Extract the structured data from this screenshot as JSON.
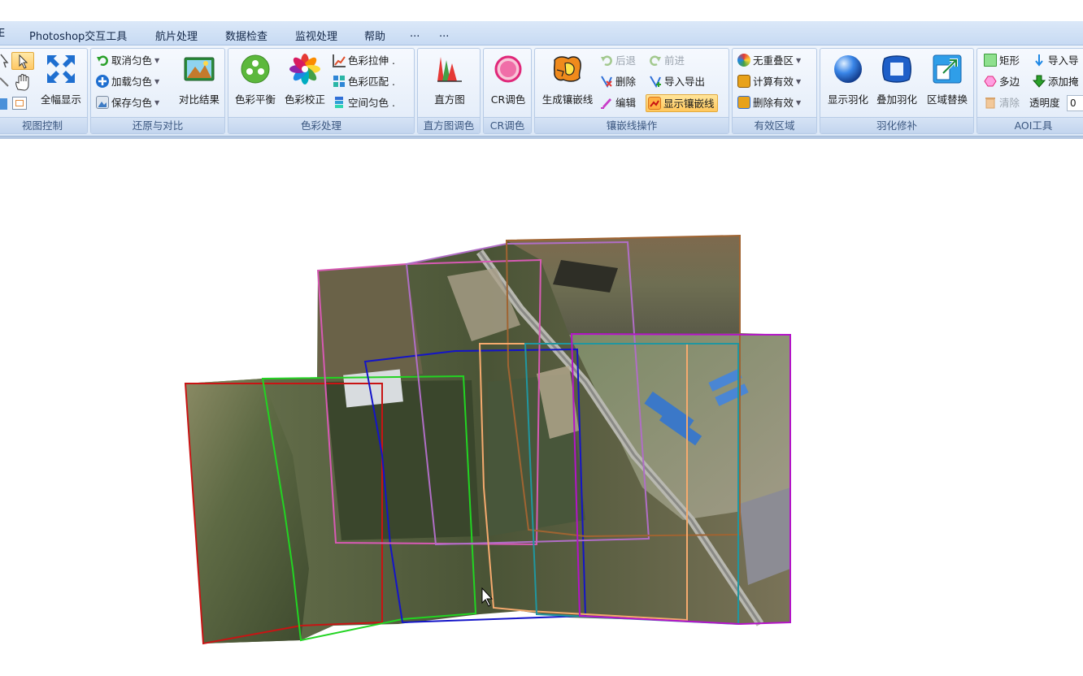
{
  "menu": [
    "E",
    "Photoshop交互工具",
    "航片处理",
    "数据检查",
    "监视处理",
    "帮助",
    "...",
    "..."
  ],
  "groups": {
    "view": {
      "label": "视图控制",
      "full_view": "全幅显示"
    },
    "restore": {
      "label": "还原与对比",
      "cancel_even": "取消匀色",
      "load_even": "加载匀色",
      "save_even": "保存匀色",
      "compare": "对比结果"
    },
    "color": {
      "label": "色彩处理",
      "balance": "色彩平衡",
      "correct": "色彩校正",
      "stretch": "色彩拉伸",
      "match": "色彩匹配",
      "spatial": "空间匀色",
      "dot": "."
    },
    "histogram": {
      "label": "直方图调色",
      "btn": "直方图"
    },
    "cr": {
      "label": "CR调色",
      "btn": "CR调色"
    },
    "seam": {
      "label": "镶嵌线操作",
      "generate": "生成镶嵌线",
      "back": "后退",
      "forward": "前进",
      "delete": "删除",
      "import_export": "导入导出",
      "edit": "编辑",
      "show": "显示镶嵌线"
    },
    "valid": {
      "label": "有效区域",
      "no_overlap": "无重叠区",
      "calc": "计算有效",
      "delete": "删除有效"
    },
    "feather": {
      "label": "羽化修补",
      "show": "显示羽化",
      "overlay": "叠加羽化",
      "replace": "区域替换"
    },
    "aoi": {
      "label": "AOI工具",
      "rect": "矩形",
      "import": "导入导",
      "polygon": "多边",
      "add_mask": "添加掩",
      "clear": "清除",
      "opacity_label": "透明度",
      "opacity_value": "0"
    }
  },
  "icons": {
    "cancel_even": "undo-arrow-icon",
    "load_even": "plus-circle-icon",
    "save_even": "save-icon",
    "compare": "landscape-image-icon",
    "balance": "color-balance-icon",
    "correct": "color-wheel-icon",
    "histogram": "histogram-icon",
    "cr": "cr-ring-icon",
    "generate": "seamline-map-icon",
    "feather_show": "blue-sphere-icon",
    "feather_overlay": "blue-square-icon",
    "feather_replace": "swap-arrows-icon"
  },
  "footprint_colors": {
    "red": "#c81414",
    "green": "#22d422",
    "blue": "#1414c8",
    "pink": "#d75ab4",
    "violet": "#b06ec6",
    "brown": "#a06432",
    "orange": "#f5aa6e",
    "teal": "#2096a0",
    "magenta": "#b414c8"
  }
}
